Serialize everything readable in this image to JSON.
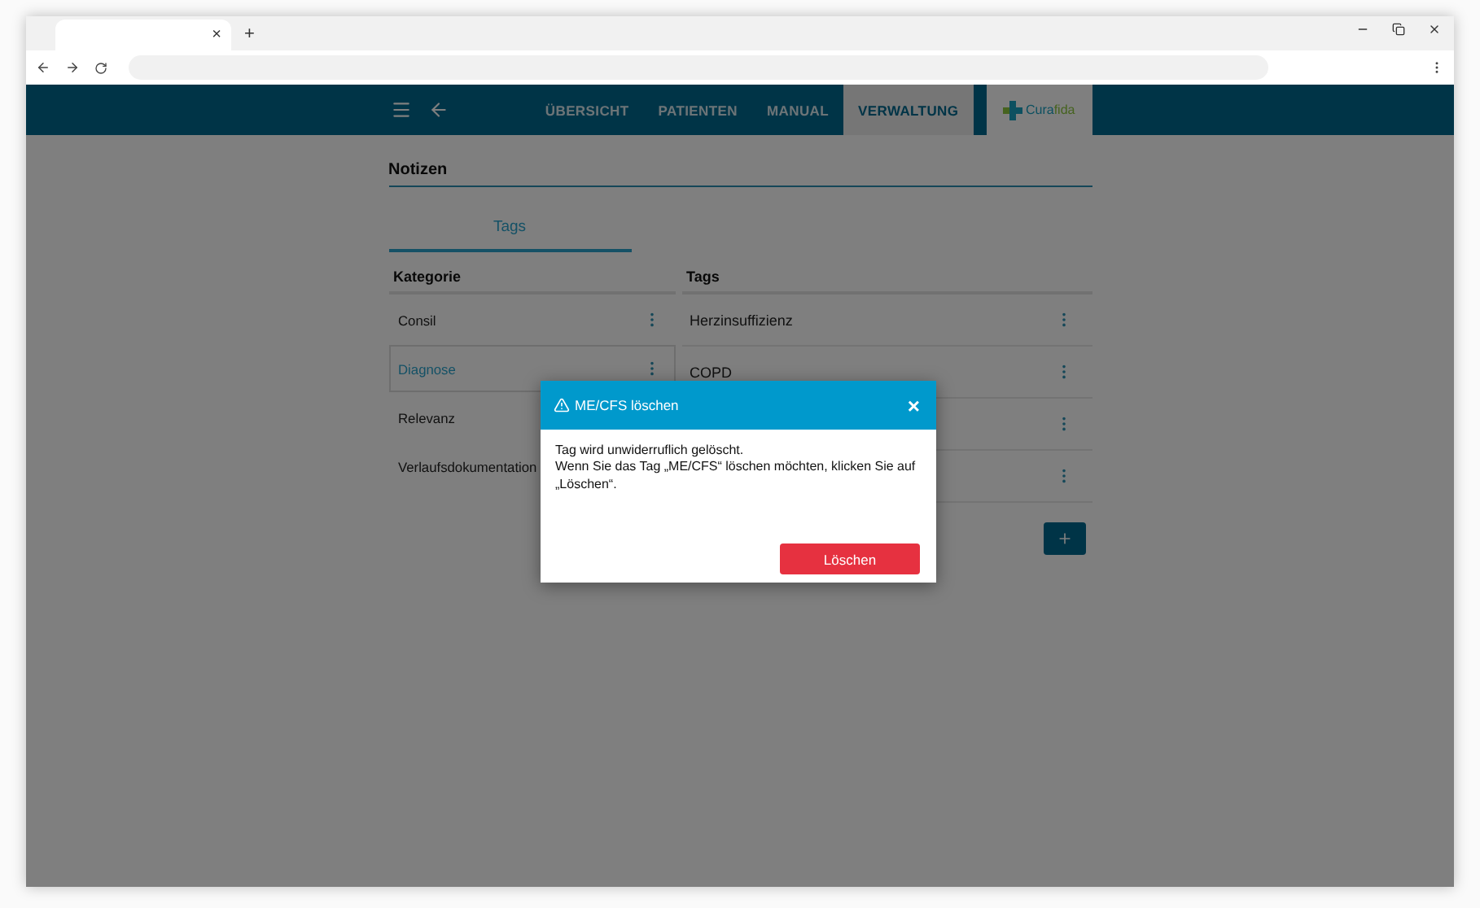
{
  "browser": {
    "tab_close": "×",
    "new_tab": "+"
  },
  "nav": {
    "items": [
      {
        "label": "ÜBERSICHT",
        "selected": false
      },
      {
        "label": "PATIENTEN",
        "selected": false
      },
      {
        "label": "MANUAL",
        "selected": false
      },
      {
        "label": "VERWALTUNG",
        "selected": true
      }
    ],
    "logo": {
      "part_1": "Cura",
      "part_2": "fida"
    }
  },
  "section": {
    "title": "Notizen",
    "tabs": [
      {
        "label": "Tags",
        "selected": true
      }
    ]
  },
  "categories": {
    "heading": "Kategorie",
    "items": [
      {
        "kind": "menu",
        "label": "Consil",
        "selected": false
      },
      {
        "kind": "menu",
        "label": "Diagnose",
        "selected": true
      },
      {
        "kind": "text",
        "label": "Relevanz",
        "selected": false
      },
      {
        "kind": "text",
        "label": "Verlaufsdokumentation",
        "selected": false
      }
    ]
  },
  "tags": {
    "heading": "Tags",
    "items": [
      {
        "kind": "text",
        "label": "Herzinsuffizienz"
      },
      {
        "kind": "text",
        "label": "COPD"
      },
      {
        "kind": "covered"
      },
      {
        "kind": "covered"
      }
    ]
  },
  "dialog": {
    "title": "ME/CFS löschen",
    "close": "×",
    "lines": [
      "Tag wird unwiderruflich gelöscht.",
      "Wenn Sie das Tag „ME/CFS“ löschen möchten, klicken Sie auf „Löschen“."
    ],
    "button": "Löschen"
  }
}
